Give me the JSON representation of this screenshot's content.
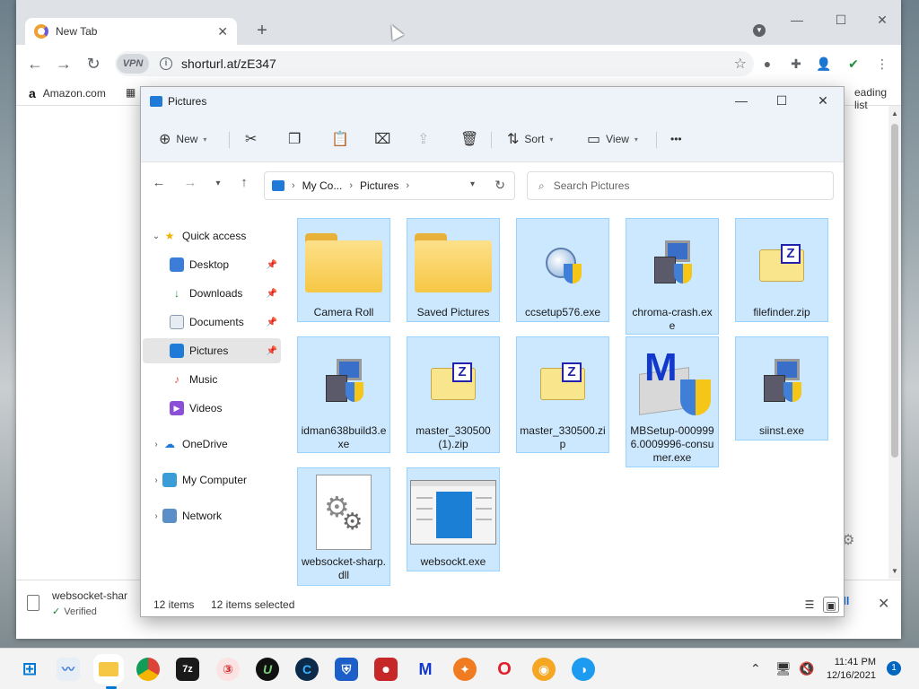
{
  "browser": {
    "tab_title": "New Tab",
    "tab_close": "✕",
    "new_tab": "+",
    "vpn": "VPN",
    "url": "shorturl.at/zE347",
    "bookmarks": [
      {
        "label": "Amazon.com"
      }
    ],
    "reading_list": "eading list",
    "download": {
      "file_name": "websocket-shar",
      "status": "Verified",
      "show_all": "all"
    }
  },
  "explorer": {
    "title": "Pictures",
    "commands": {
      "new": "New",
      "sort": "Sort",
      "view": "View",
      "more": "•••"
    },
    "breadcrumb": {
      "root": "My Co...",
      "current": "Pictures"
    },
    "search_placeholder": "Search Pictures",
    "nav": {
      "quick_access": "Quick access",
      "desktop": "Desktop",
      "downloads": "Downloads",
      "documents": "Documents",
      "pictures": "Pictures",
      "music": "Music",
      "videos": "Videos",
      "onedrive": "OneDrive",
      "my_computer": "My Computer",
      "network": "Network"
    },
    "files": [
      {
        "name": "Camera Roll",
        "icon": "folder-icon"
      },
      {
        "name": "Saved Pictures",
        "icon": "folder-icon"
      },
      {
        "name": "ccsetup576.exe",
        "icon": "ccleaner-installer-icon"
      },
      {
        "name": "chroma-crash.exe",
        "icon": "installer-icon"
      },
      {
        "name": "filefinder.zip",
        "icon": "zip-icon"
      },
      {
        "name": "idman638build3.exe",
        "icon": "installer-icon"
      },
      {
        "name": "master_330500 (1).zip",
        "icon": "zip-icon"
      },
      {
        "name": "master_330500.zip",
        "icon": "zip-icon"
      },
      {
        "name": "MBSetup-0009996.0009996-consumer.exe",
        "icon": "malwarebytes-installer-icon"
      },
      {
        "name": "siinst.exe",
        "icon": "installer-icon"
      },
      {
        "name": "websocket-sharp.dll",
        "icon": "dll-icon"
      },
      {
        "name": "websockt.exe",
        "icon": "app-window-icon"
      }
    ],
    "status": {
      "items": "12 items",
      "selected": "12 items selected"
    }
  },
  "taskbar": {
    "clock_time": "11:41 PM",
    "clock_date": "12/16/2021",
    "notification_count": "1"
  },
  "colors": {
    "selection_fill": "#cce8ff",
    "selection_border": "#99d1ff",
    "accent": "#1f7ad8"
  }
}
